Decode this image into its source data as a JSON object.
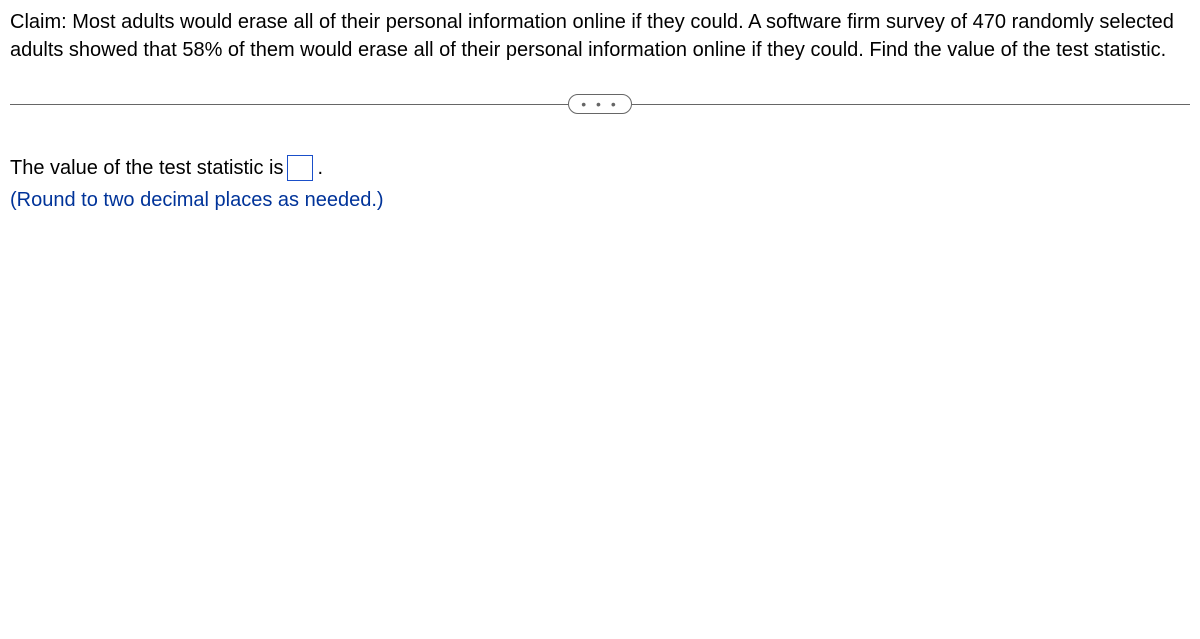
{
  "question": {
    "text": "Claim: Most adults would erase all of their personal information online if they could. A software firm survey of 470 randomly selected adults showed that 58% of them would erase all of their personal information online if they could. Find the value of the test statistic."
  },
  "divider": {
    "dots": "• • •"
  },
  "answer": {
    "prefix": "The value of the test statistic is",
    "input_value": "",
    "suffix": ".",
    "instruction": "(Round to two decimal places as needed.)"
  }
}
